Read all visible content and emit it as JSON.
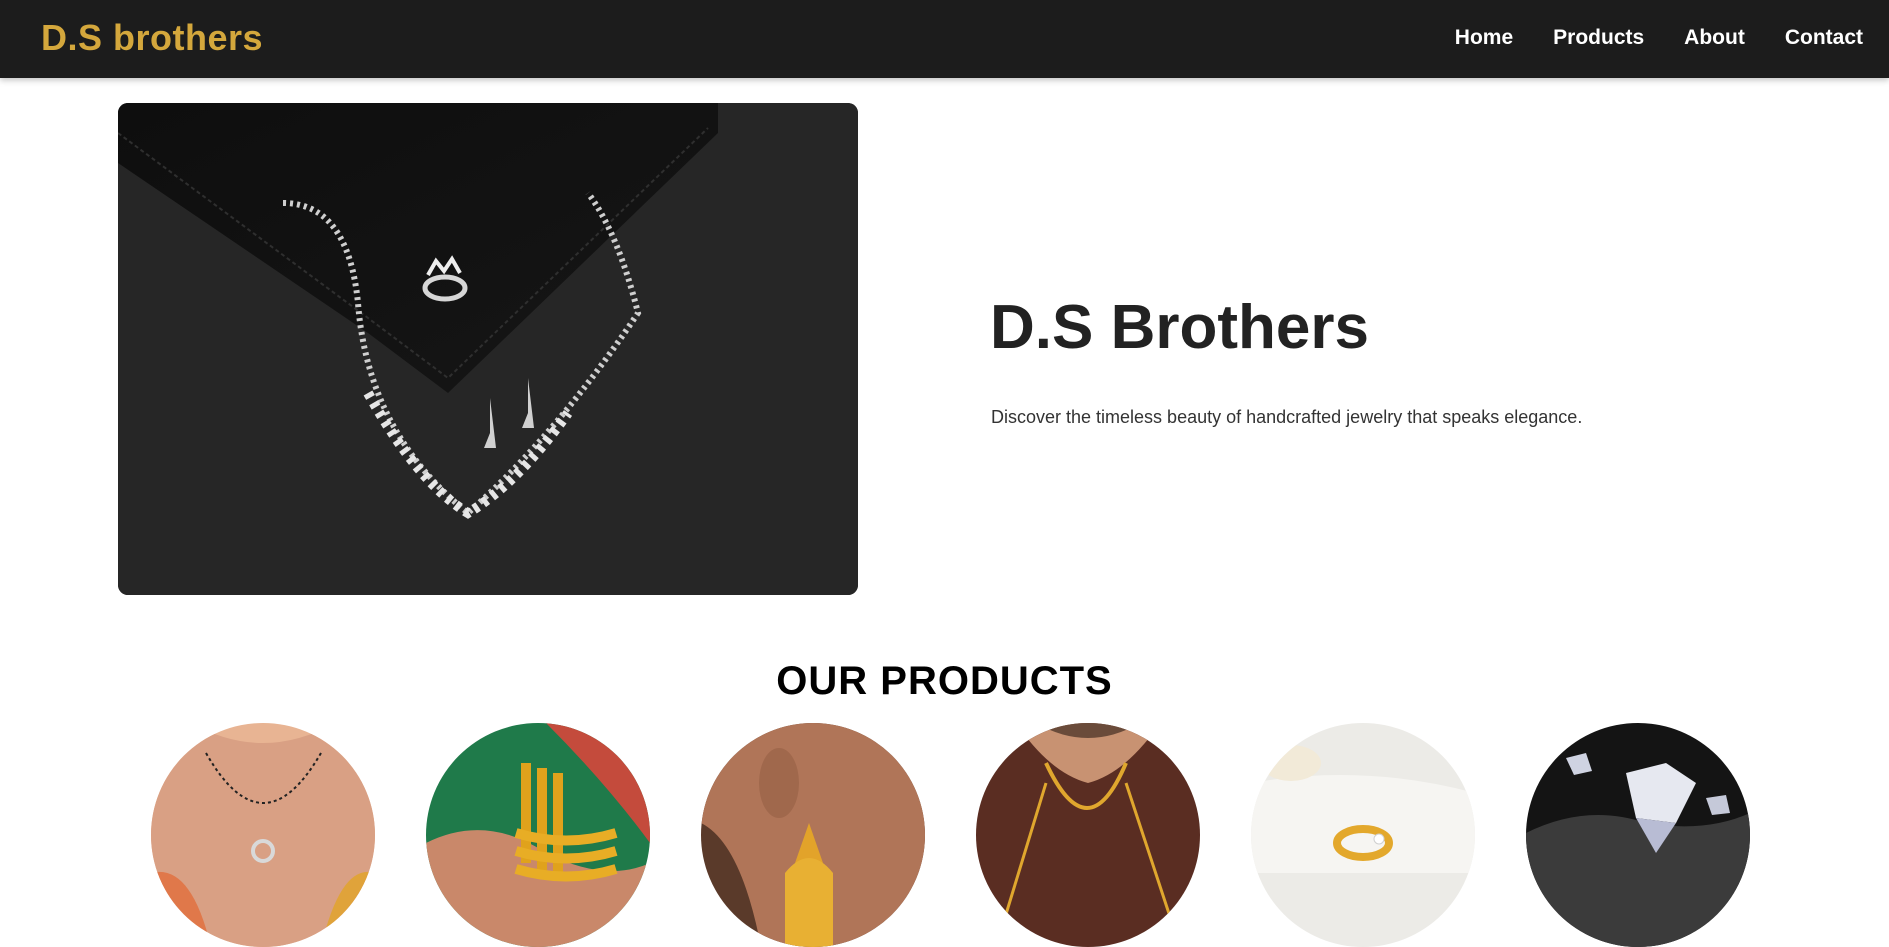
{
  "navbar": {
    "brand": "D.S brothers",
    "links": [
      "Home",
      "Products",
      "About",
      "Contact"
    ]
  },
  "hero": {
    "title": "D.S Brothers",
    "subtitle": "Discover the timeless beauty of handcrafted jewelry that speaks elegance."
  },
  "products": {
    "heading": "OUR PRODUCTS"
  },
  "colors": {
    "navbar_bg": "#1c1c1c",
    "brand_gold": "#d4a73c",
    "text_dark": "#222222"
  }
}
